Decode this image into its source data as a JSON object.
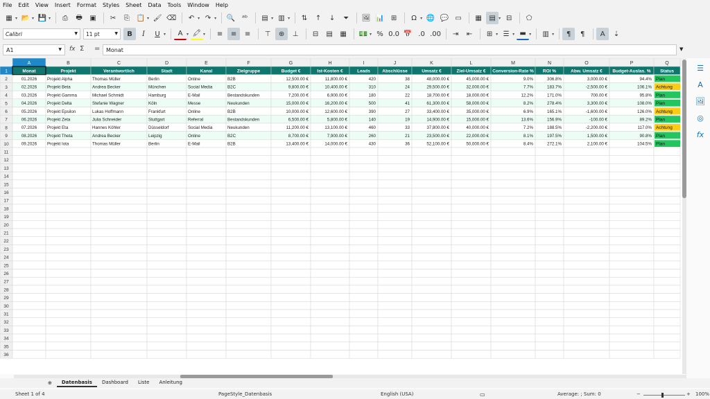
{
  "menu": [
    "File",
    "Edit",
    "View",
    "Insert",
    "Format",
    "Styles",
    "Sheet",
    "Data",
    "Tools",
    "Window",
    "Help"
  ],
  "toolbar": {
    "font_name": "Calibri",
    "font_size": "11 pt"
  },
  "formula_bar": {
    "cell_ref": "A1",
    "content": "Monat",
    "fx": "fx",
    "sum": "Σ",
    "eq": "="
  },
  "columns": [
    "A",
    "B",
    "C",
    "D",
    "E",
    "F",
    "G",
    "H",
    "I",
    "J",
    "K",
    "L",
    "M",
    "N",
    "O",
    "P",
    "Q"
  ],
  "headers": [
    "Monat",
    "Projekt",
    "Verantwortlich",
    "Stadt",
    "Kanal",
    "Zielgruppe",
    "Budget €",
    "Ist-Kosten €",
    "Leads",
    "Abschlüsse",
    "Umsatz €",
    "Ziel-Umsatz €",
    "Conversion-Rate %",
    "ROI %",
    "Abw. Umsatz €",
    "Budget-Auslas. %",
    "Status"
  ],
  "rows": [
    [
      "01.2026",
      "Projekt Alpha",
      "Thomas Müller",
      "Berlin",
      "Online",
      "B2B",
      "12,500.00 €",
      "11,800.00 €",
      "420",
      "38",
      "48,000.00 €",
      "45,000.00 €",
      "9.0%",
      "306.8%",
      "3,000.00 €",
      "94.4%",
      "Plan"
    ],
    [
      "02.2026",
      "Projekt Beta",
      "Andrea Becker",
      "München",
      "Social Media",
      "B2C",
      "9,800.00 €",
      "10,400.00 €",
      "310",
      "24",
      "29,500.00 €",
      "32,000.00 €",
      "7.7%",
      "183.7%",
      "-2,500.00 €",
      "106.1%",
      "Achtung"
    ],
    [
      "03.2026",
      "Projekt Gamma",
      "Michael Schmidt",
      "Hamburg",
      "E-Mail",
      "Bestandskunden",
      "7,200.00 €",
      "6,900.00 €",
      "180",
      "22",
      "18,700.00 €",
      "18,000.00 €",
      "12.2%",
      "171.0%",
      "700.00 €",
      "95.8%",
      "Plan"
    ],
    [
      "04.2026",
      "Projekt Delta",
      "Stefanie Wagner",
      "Köln",
      "Messe",
      "Neukunden",
      "15,000.00 €",
      "16,200.00 €",
      "500",
      "41",
      "61,300.00 €",
      "58,000.00 €",
      "8.2%",
      "278.4%",
      "3,300.00 €",
      "108.0%",
      "Plan"
    ],
    [
      "05.2026",
      "Projekt Epsilon",
      "Lukas Hoffmann",
      "Frankfurt",
      "Online",
      "B2B",
      "10,000.00 €",
      "12,600.00 €",
      "390",
      "27",
      "33,400.00 €",
      "35,000.00 €",
      "6.9%",
      "165.1%",
      "-1,600.00 €",
      "126.0%",
      "Achtung"
    ],
    [
      "06.2026",
      "Projekt Zeta",
      "Julia Schneider",
      "Stuttgart",
      "Referral",
      "Bestandskunden",
      "6,500.00 €",
      "5,800.00 €",
      "140",
      "19",
      "14,900.00 €",
      "15,000.00 €",
      "13.6%",
      "156.9%",
      "-100.00 €",
      "89.2%",
      "Plan"
    ],
    [
      "07.2026",
      "Projekt Eta",
      "Hannes Köhler",
      "Düsseldorf",
      "Social Media",
      "Neukunden",
      "11,200.00 €",
      "13,100.00 €",
      "460",
      "33",
      "37,800.00 €",
      "40,000.00 €",
      "7.2%",
      "188.5%",
      "-2,200.00 €",
      "117.0%",
      "Achtung"
    ],
    [
      "08.2026",
      "Projekt Theta",
      "Andrea Becker",
      "Leipzig",
      "Online",
      "B2C",
      "8,700.00 €",
      "7,900.00 €",
      "260",
      "21",
      "23,500.00 €",
      "22,000.00 €",
      "8.1%",
      "197.5%",
      "1,500.00 €",
      "90.8%",
      "Plan"
    ],
    [
      "09.2026",
      "Projekt Iota",
      "Thomas Müller",
      "Berlin",
      "E-Mail",
      "B2B",
      "13,400.00 €",
      "14,000.00 €",
      "430",
      "36",
      "52,100.00 €",
      "50,000.00 €",
      "8.4%",
      "272.1%",
      "2,100.00 €",
      "104.5%",
      "Plan"
    ]
  ],
  "status_colors": {
    "Plan": "#22c55e",
    "Achtung": "#facc15"
  },
  "colors": {
    "header_bg": "#0f766e",
    "header_text": "#ffffff",
    "row_alt": "#ecfdf5",
    "row_base": "#ffffff",
    "grid": "#d4d4d4",
    "rowhdr_bg": "#f0f0f0",
    "selected_hdr": "#1e88c8"
  },
  "sheet_tabs": [
    "Datenbasis",
    "Dashboard",
    "Liste",
    "Anleitung"
  ],
  "active_tab": "Datenbasis",
  "status": {
    "sheet": "Sheet 1 of 4",
    "page_style": "PageStyle_Datenbasis",
    "language": "English (USA)",
    "summary": "Average: ; Sum: 0",
    "zoom": "100%"
  }
}
